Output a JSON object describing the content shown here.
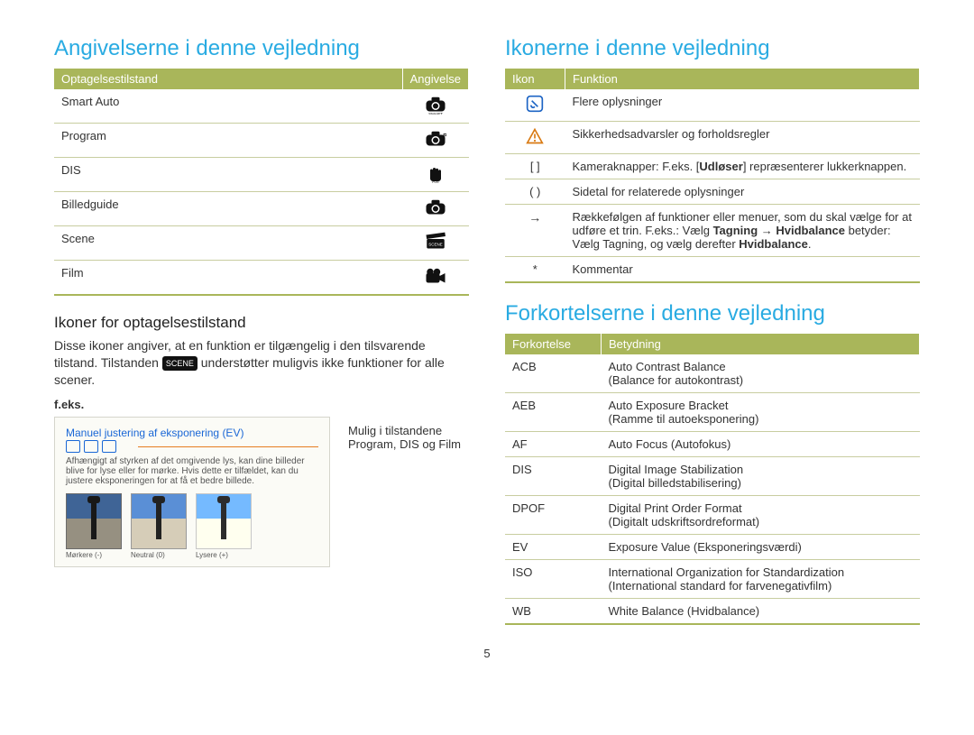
{
  "left": {
    "heading": "Angivelserne i denne vejledning",
    "modes_table": {
      "headers": [
        "Optagelsestilstand",
        "Angivelse"
      ],
      "rows": [
        {
          "name": "Smart Auto",
          "icon": "camera-smart-icon"
        },
        {
          "name": "Program",
          "icon": "camera-p-icon"
        },
        {
          "name": "DIS",
          "icon": "hand-dis-icon"
        },
        {
          "name": "Billedguide",
          "icon": "camera-guide-icon"
        },
        {
          "name": "Scene",
          "icon": "clapper-scene-icon"
        },
        {
          "name": "Film",
          "icon": "film-camera-icon"
        }
      ]
    },
    "sub_heading": "Ikoner for optagelsestilstand",
    "sub_text_before": "Disse ikoner angiver, at en funktion er tilgængelig i den tilsvarende tilstand. Tilstanden ",
    "sub_badge_icon": "scene-badge-icon",
    "sub_text_after": " understøtter muligvis ikke funktioner for alle scener.",
    "feks": "f.eks.",
    "example": {
      "title": "Manuel justering af eksponering (EV)",
      "desc": "Afhængigt af styrken af det omgivende lys, kan dine billeder blive for lyse eller for mørke. Hvis dette er tilfældet, kan du justere eksponeringen for at få et bedre billede.",
      "thumbs": [
        "Mørkere (-)",
        "Neutral (0)",
        "Lysere (+)"
      ]
    },
    "example_note": "Mulig i tilstandene Program, DIS og Film"
  },
  "right": {
    "icons_heading": "Ikonerne i denne vejledning",
    "icons_table": {
      "headers": [
        "Ikon",
        "Funktion"
      ],
      "rows": [
        {
          "icon": "info-icon",
          "glyph": "ℹ",
          "text": "Flere oplysninger"
        },
        {
          "icon": "warning-icon",
          "glyph": "⚠",
          "text": "Sikkerhedsadvarsler og forholdsregler"
        },
        {
          "icon": "brackets-icon",
          "glyph": "[ ]",
          "html": "Kameraknapper: F.eks. [<b>Udløser</b>] repræsenterer lukkerknappen."
        },
        {
          "icon": "paren-icon",
          "glyph": "( )",
          "text": "Sidetal for relaterede oplysninger"
        },
        {
          "icon": "arrow-icon",
          "glyph": "→",
          "html": "Rækkefølgen af funktioner eller menuer, som du skal vælge for at udføre et trin. F.eks.: Vælg <b>Tagning</b> → <b>Hvidbalance</b> betyder: Vælg Tagning, og vælg derefter <b>Hvidbalance</b>."
        },
        {
          "icon": "asterisk-icon",
          "glyph": "*",
          "text": "Kommentar"
        }
      ]
    },
    "abbr_heading": "Forkortelserne i denne vejledning",
    "abbr_table": {
      "headers": [
        "Forkortelse",
        "Betydning"
      ],
      "rows": [
        {
          "abbr": "ACB",
          "meaning": "Auto Contrast Balance\n(Balance for autokontrast)"
        },
        {
          "abbr": "AEB",
          "meaning": "Auto Exposure Bracket\n(Ramme til autoeksponering)"
        },
        {
          "abbr": "AF",
          "meaning": "Auto Focus (Autofokus)"
        },
        {
          "abbr": "DIS",
          "meaning": "Digital Image Stabilization\n(Digital billedstabilisering)"
        },
        {
          "abbr": "DPOF",
          "meaning": "Digital Print Order Format\n(Digitalt udskriftsordreformat)"
        },
        {
          "abbr": "EV",
          "meaning": "Exposure Value (Eksponeringsværdi)"
        },
        {
          "abbr": "ISO",
          "meaning": "International Organization for Standardization\n(International standard for farvenegativfilm)"
        },
        {
          "abbr": "WB",
          "meaning": "White Balance (Hvidbalance)"
        }
      ]
    }
  },
  "page_number": "5"
}
